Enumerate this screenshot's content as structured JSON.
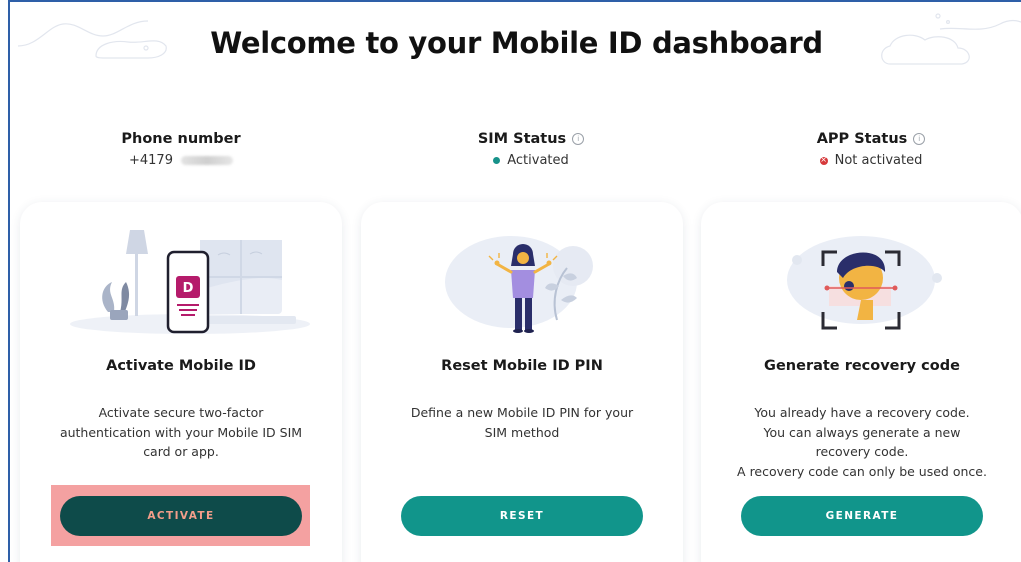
{
  "page": {
    "title": "Welcome to your Mobile ID dashboard"
  },
  "status": {
    "phone": {
      "label": "Phone number",
      "value_prefix": "+4179"
    },
    "sim": {
      "label": "SIM Status",
      "value": "Activated",
      "state_color": "#17928a"
    },
    "app": {
      "label": "APP Status",
      "value": "Not activated",
      "state_color": "#d6393b"
    }
  },
  "cards": [
    {
      "title": "Activate Mobile ID",
      "desc_lines": [
        "Activate secure two-factor",
        "authentication with your Mobile ID SIM",
        "card or app."
      ],
      "button": "ACTIVATE",
      "icon": "phone-mobile-id-illustration"
    },
    {
      "title": "Reset Mobile ID PIN",
      "desc_lines": [
        "Define a new Mobile ID PIN for your",
        "SIM method"
      ],
      "button": "RESET",
      "icon": "person-shrug-illustration"
    },
    {
      "title": "Generate recovery code",
      "desc_lines": [
        "You already have a recovery code.",
        "You can always generate a new",
        "recovery code.",
        "A recovery code can only be used once."
      ],
      "button": "GENERATE",
      "icon": "face-scan-illustration"
    }
  ],
  "colors": {
    "accent": "#11958b",
    "accent_dark": "#0e4b4a",
    "highlight": "#f39c9c"
  }
}
